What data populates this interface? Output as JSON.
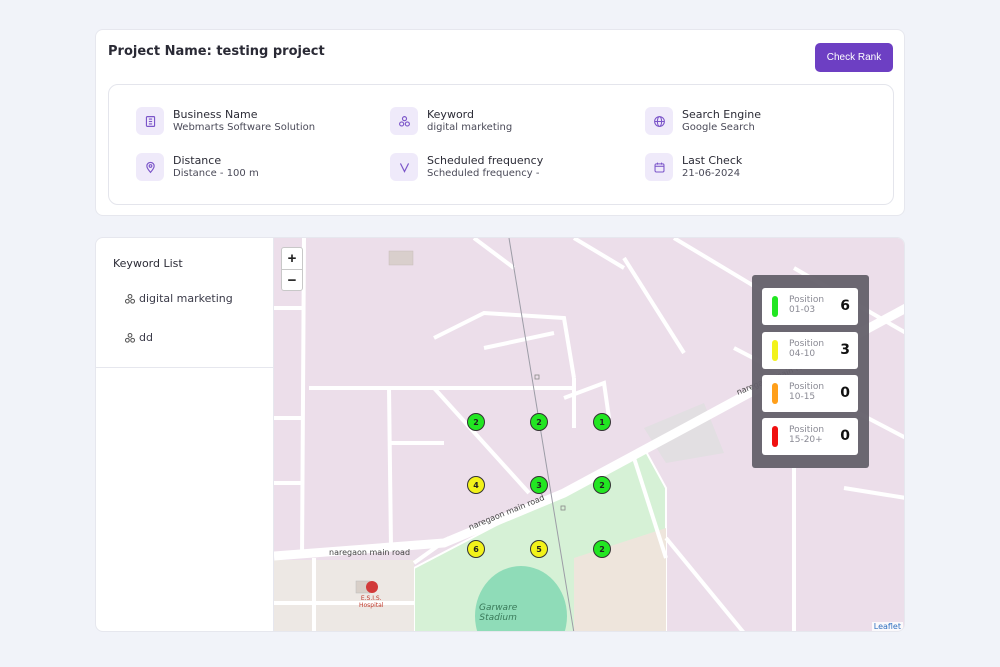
{
  "header": {
    "project_title": "Project Name: testing project",
    "check_rank_label": "Check Rank"
  },
  "info": [
    {
      "label": "Business Name",
      "value": "Webmarts Software Solution",
      "icon": "building-icon"
    },
    {
      "label": "Keyword",
      "value": "digital marketing",
      "icon": "keyword-icon"
    },
    {
      "label": "Search Engine",
      "value": "Google Search",
      "icon": "globe-icon"
    },
    {
      "label": "Distance",
      "value": "Distance - 100 m",
      "icon": "location-pin-icon"
    },
    {
      "label": "Scheduled frequency",
      "value": "Scheduled frequency -",
      "icon": "frequency-icon"
    },
    {
      "label": "Last Check",
      "value": "21-06-2024",
      "icon": "calendar-icon"
    }
  ],
  "keyword_list": {
    "title": "Keyword List",
    "items": [
      "digital marketing",
      "dd"
    ]
  },
  "map": {
    "zoom_in": "+",
    "zoom_out": "−",
    "attribution": "Leaflet",
    "labels": {
      "road_1": "naregaon main road",
      "road_2": "naregaon main road",
      "road_3": "naregaon main road",
      "hospital": "E.S.I.S.\nHospital",
      "stadium": "Garware\nStadium"
    },
    "markers": [
      {
        "rank": "2",
        "color": "green"
      },
      {
        "rank": "2",
        "color": "green"
      },
      {
        "rank": "1",
        "color": "green"
      },
      {
        "rank": "4",
        "color": "yellow"
      },
      {
        "rank": "3",
        "color": "green"
      },
      {
        "rank": "2",
        "color": "green"
      },
      {
        "rank": "6",
        "color": "yellow"
      },
      {
        "rank": "5",
        "color": "yellow"
      },
      {
        "rank": "2",
        "color": "green"
      }
    ]
  },
  "legend": [
    {
      "label": "Position",
      "range": "01-03",
      "count": "6",
      "color": "#22e622"
    },
    {
      "label": "Position",
      "range": "04-10",
      "count": "3",
      "color": "#f2f21a"
    },
    {
      "label": "Position",
      "range": "10-15",
      "count": "0",
      "color": "#ff9f1a"
    },
    {
      "label": "Position",
      "range": "15-20+",
      "count": "0",
      "color": "#f01010"
    }
  ],
  "colors": {
    "accent": "#6d3fc3",
    "icon_bg": "#efeafa",
    "map_bg": "#ecdeea"
  }
}
